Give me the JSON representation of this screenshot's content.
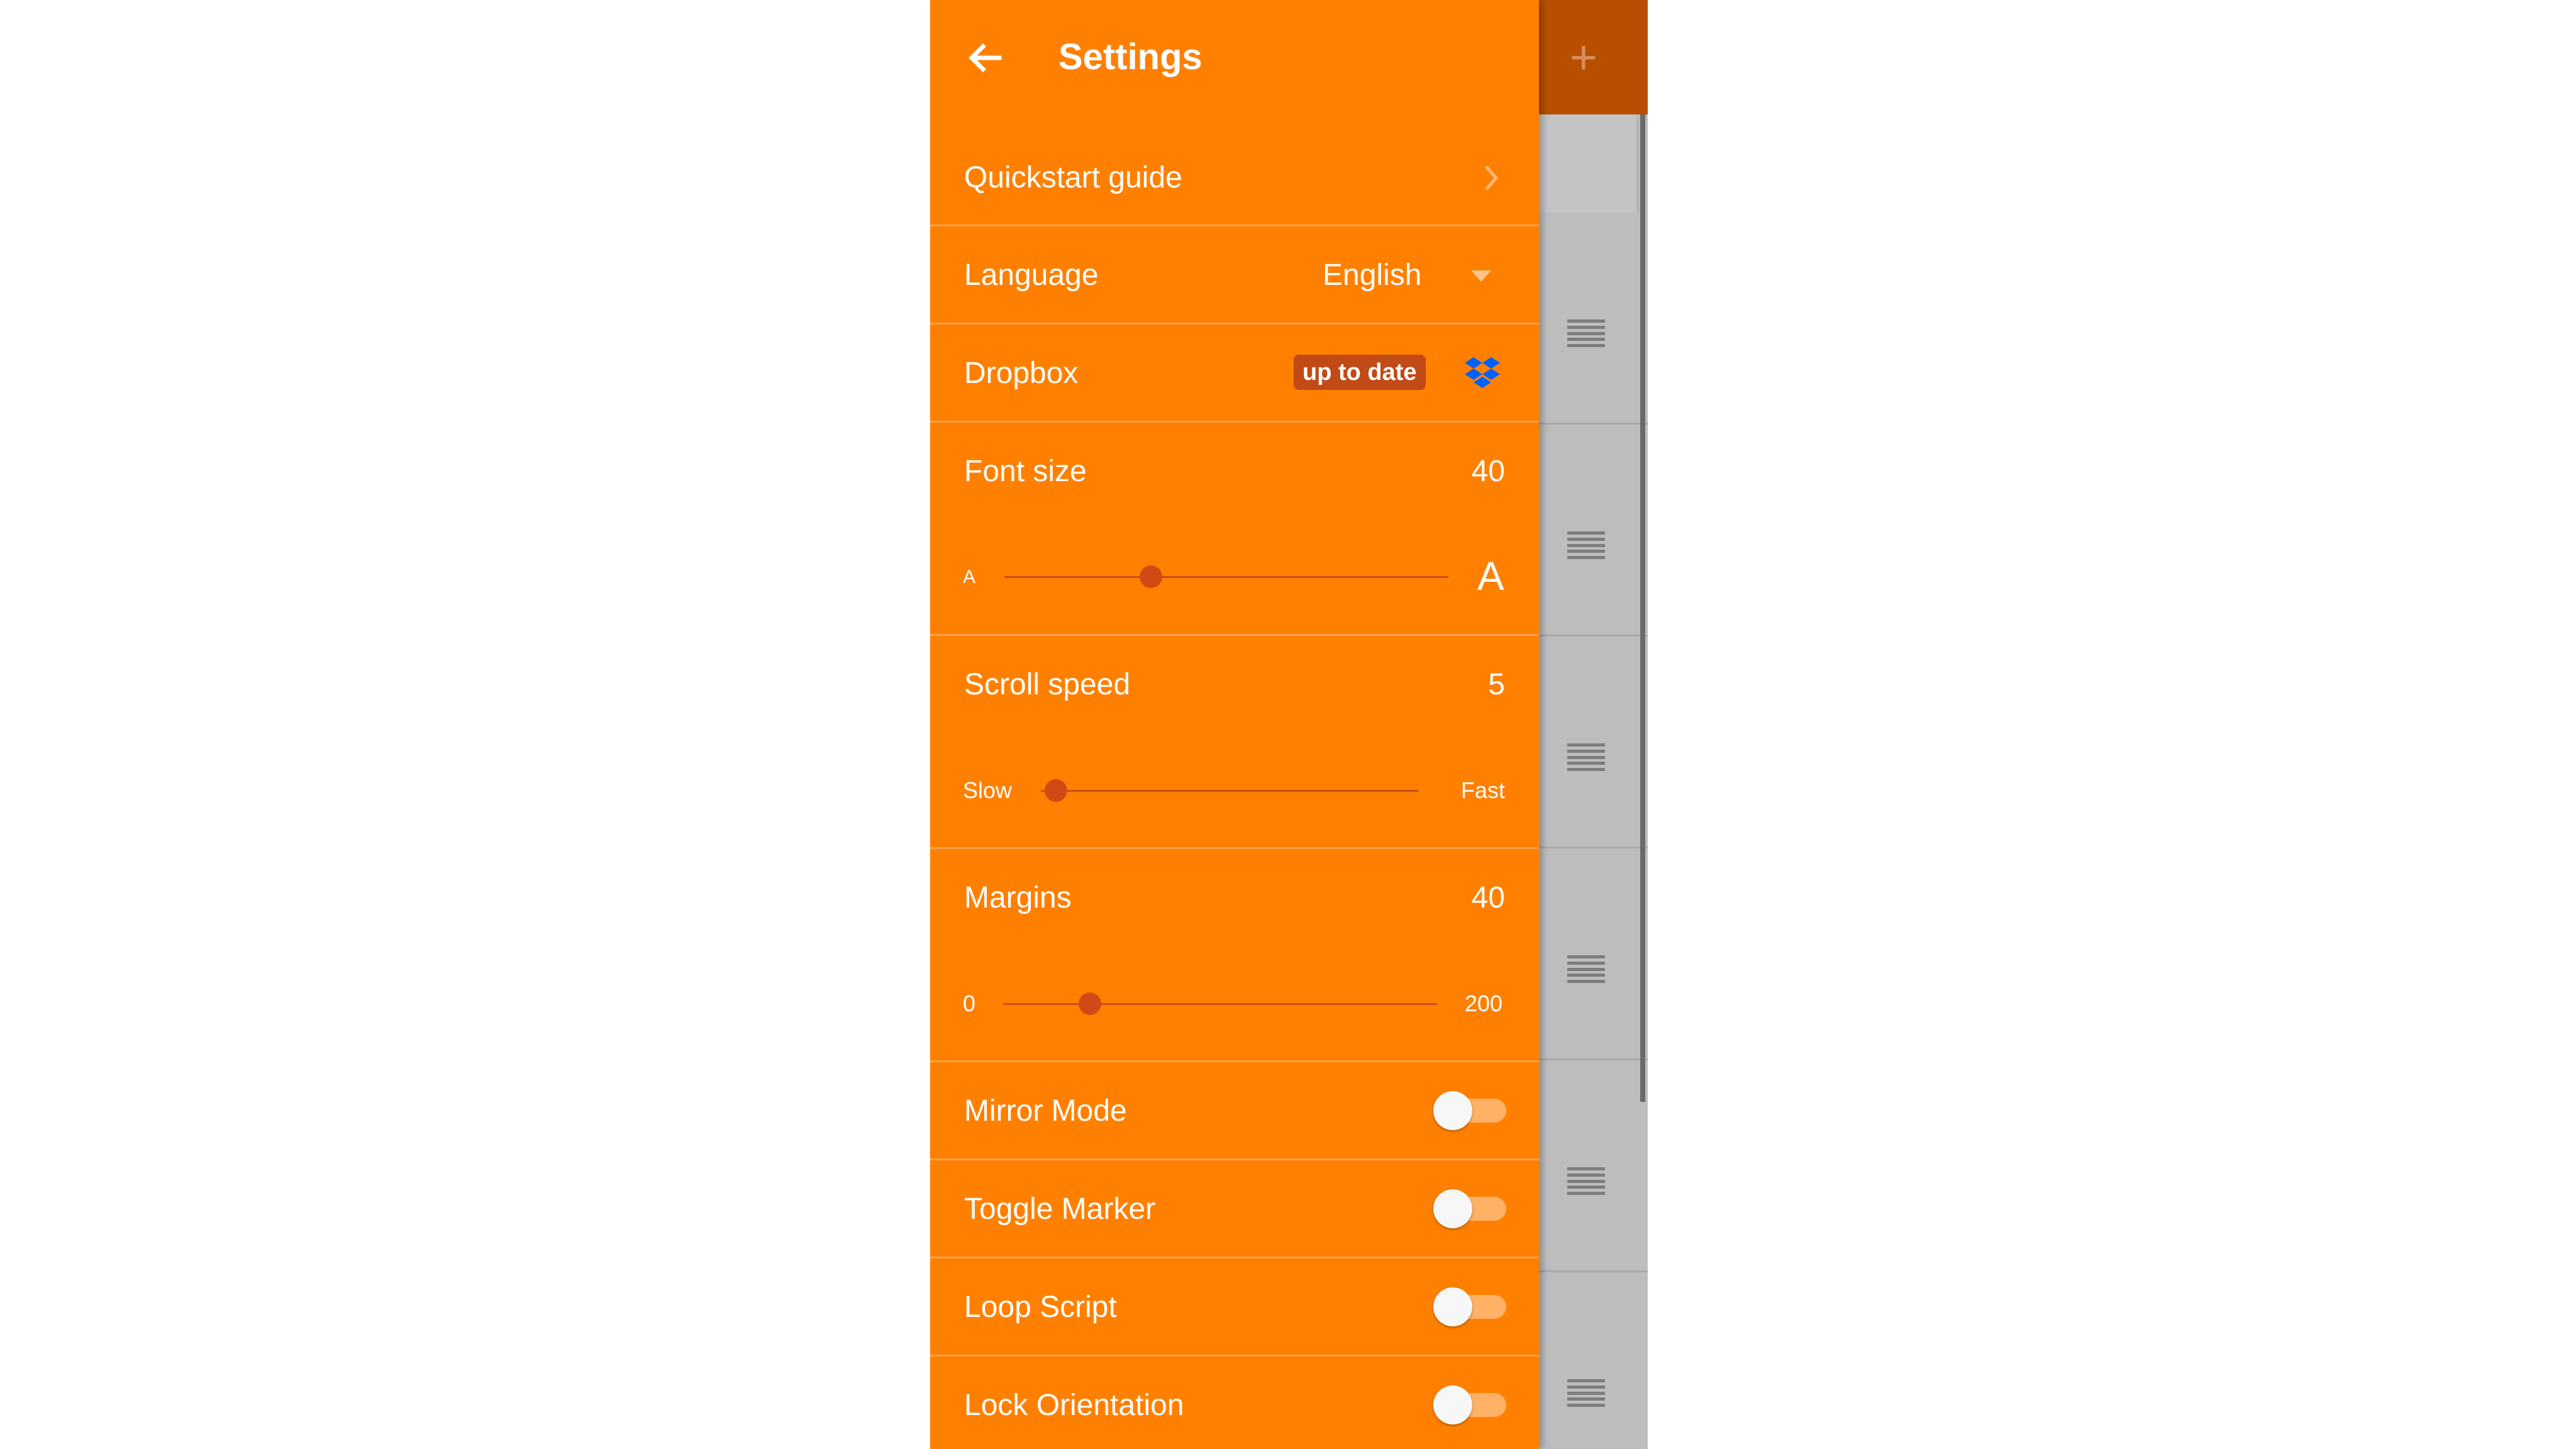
{
  "header": {
    "title": "Settings"
  },
  "background_app": {
    "add_icon": "plus-icon",
    "handle_icon": "drag-handle-icon",
    "row_count": 6
  },
  "colors": {
    "drawer_background": "#ff8000",
    "accent": "#d14a16",
    "badge": "#c24a16",
    "dropbox_blue": "#0061fe",
    "toggle_track_off": "#ffb266"
  },
  "settings": {
    "quickstart": {
      "label": "Quickstart guide",
      "icon": "chevron-right-icon"
    },
    "language": {
      "label": "Language",
      "value": "English",
      "icon": "dropdown-arrow-icon"
    },
    "dropbox": {
      "label": "Dropbox",
      "status": "up to date",
      "icon": "dropbox-icon"
    },
    "font_size": {
      "label": "Font size",
      "value": "40",
      "min_label": "A",
      "max_label": "A",
      "level": 0.33
    },
    "scroll_speed": {
      "label": "Scroll speed",
      "value": "5",
      "min_label": "Slow",
      "max_label": "Fast",
      "level": 0.04
    },
    "margins": {
      "label": "Margins",
      "value": "40",
      "min_label": "0",
      "max_label": "200",
      "level": 0.2
    },
    "toggles": [
      {
        "label": "Mirror Mode",
        "on": false
      },
      {
        "label": "Toggle Marker",
        "on": false
      },
      {
        "label": "Loop Script",
        "on": false
      },
      {
        "label": "Lock Orientation",
        "on": false
      }
    ]
  }
}
